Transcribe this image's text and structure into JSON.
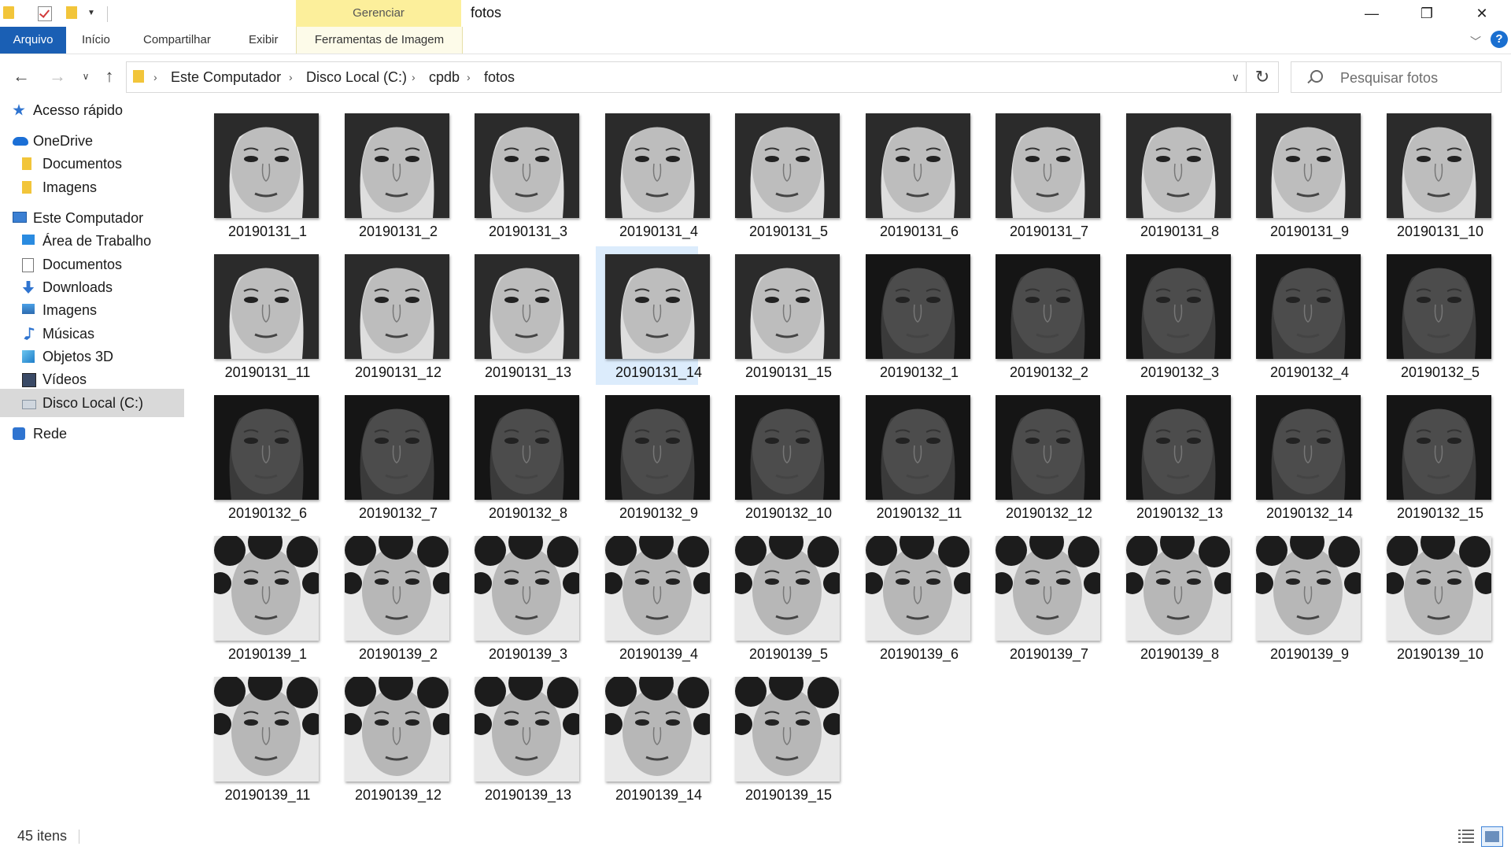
{
  "window": {
    "title": "fotos",
    "context_tab_group": "Gerenciar",
    "minimize_glyph": "—",
    "maximize_glyph": "❐",
    "close_glyph": "✕"
  },
  "ribbon": {
    "tabs": [
      "Arquivo",
      "Início",
      "Compartilhar",
      "Exibir",
      "Ferramentas de Imagem"
    ],
    "active_tab": "Arquivo",
    "help_glyph": "?"
  },
  "address": {
    "breadcrumbs": [
      "Este Computador",
      "Disco Local (C:)",
      "cpdb",
      "fotos"
    ]
  },
  "search": {
    "placeholder": "Pesquisar fotos"
  },
  "sidebar": {
    "items": [
      {
        "label": "Acesso rápido",
        "icon": "star-icon"
      },
      {
        "label": "OneDrive",
        "icon": "cloud-icon"
      },
      {
        "label": "Documentos",
        "icon": "folder-icon"
      },
      {
        "label": "Imagens",
        "icon": "folder-icon"
      },
      {
        "label": "Este Computador",
        "icon": "computer-icon"
      },
      {
        "label": "Área de Trabalho",
        "icon": "desktop-icon"
      },
      {
        "label": "Documentos",
        "icon": "documents-icon"
      },
      {
        "label": "Downloads",
        "icon": "download-icon"
      },
      {
        "label": "Imagens",
        "icon": "pictures-icon"
      },
      {
        "label": "Músicas",
        "icon": "music-icon"
      },
      {
        "label": "Objetos 3D",
        "icon": "cube-icon"
      },
      {
        "label": "Vídeos",
        "icon": "video-icon"
      },
      {
        "label": "Disco Local (C:)",
        "icon": "drive-icon"
      },
      {
        "label": "Rede",
        "icon": "network-icon"
      }
    ],
    "selected_label": "Disco Local (C:)"
  },
  "files": [
    {
      "name": "20190131_1"
    },
    {
      "name": "20190131_2"
    },
    {
      "name": "20190131_3"
    },
    {
      "name": "20190131_4"
    },
    {
      "name": "20190131_5"
    },
    {
      "name": "20190131_6"
    },
    {
      "name": "20190131_7"
    },
    {
      "name": "20190131_8"
    },
    {
      "name": "20190131_9"
    },
    {
      "name": "20190131_10"
    },
    {
      "name": "20190131_11"
    },
    {
      "name": "20190131_12"
    },
    {
      "name": "20190131_13"
    },
    {
      "name": "20190131_14"
    },
    {
      "name": "20190131_15"
    },
    {
      "name": "20190132_1"
    },
    {
      "name": "20190132_2"
    },
    {
      "name": "20190132_3"
    },
    {
      "name": "20190132_4"
    },
    {
      "name": "20190132_5"
    },
    {
      "name": "20190132_6"
    },
    {
      "name": "20190132_7"
    },
    {
      "name": "20190132_8"
    },
    {
      "name": "20190132_9"
    },
    {
      "name": "20190132_10"
    },
    {
      "name": "20190132_11"
    },
    {
      "name": "20190132_12"
    },
    {
      "name": "20190132_13"
    },
    {
      "name": "20190132_14"
    },
    {
      "name": "20190132_15"
    },
    {
      "name": "20190139_1"
    },
    {
      "name": "20190139_2"
    },
    {
      "name": "20190139_3"
    },
    {
      "name": "20190139_4"
    },
    {
      "name": "20190139_5"
    },
    {
      "name": "20190139_6"
    },
    {
      "name": "20190139_7"
    },
    {
      "name": "20190139_8"
    },
    {
      "name": "20190139_9"
    },
    {
      "name": "20190139_10"
    },
    {
      "name": "20190139_11"
    },
    {
      "name": "20190139_12"
    },
    {
      "name": "20190139_13"
    },
    {
      "name": "20190139_14"
    },
    {
      "name": "20190139_15"
    }
  ],
  "selected_file": "20190131_14",
  "status": {
    "item_count": "45 itens"
  },
  "colors": {
    "accent": "#1a5fb4",
    "context_tab": "#fcef9b",
    "selection": "#dcecfc",
    "sidebar_selected": "#d9d9d9",
    "folder": "#f2c53a"
  }
}
